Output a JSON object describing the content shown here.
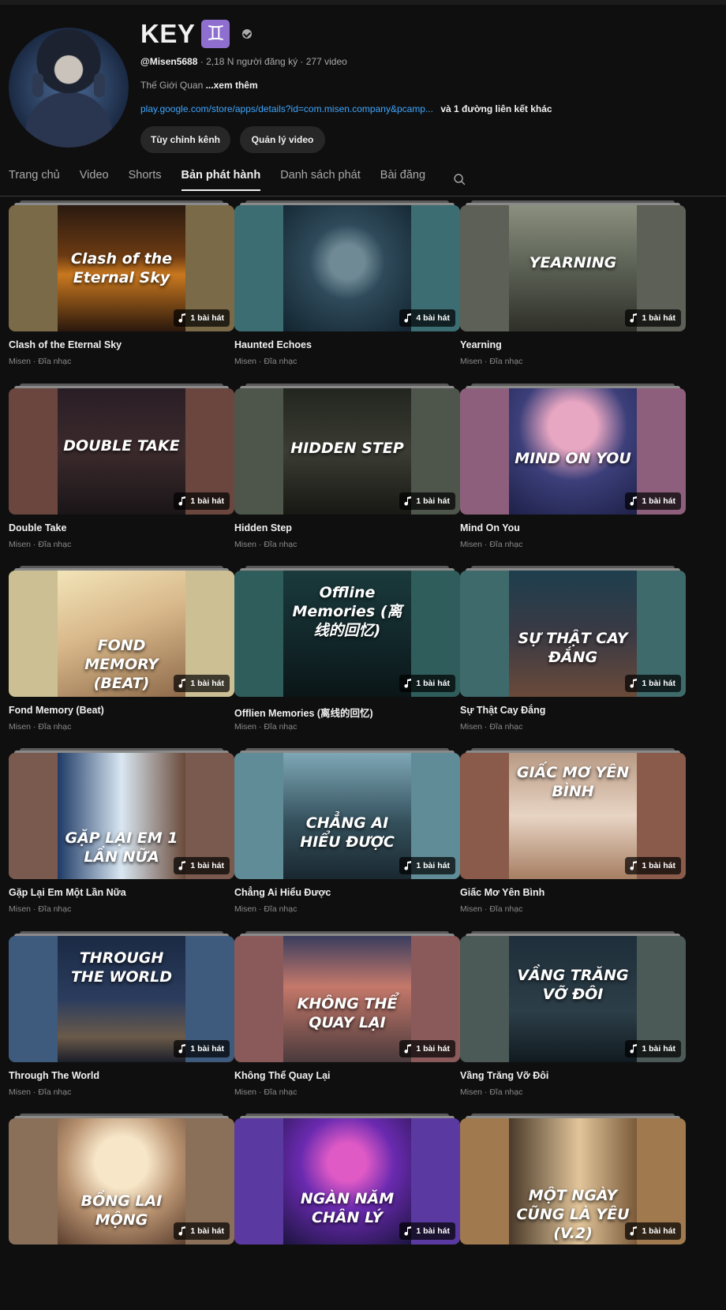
{
  "channel": {
    "name": "KEY",
    "badge_glyph": "♊",
    "handle": "@Misen5688",
    "subscribers": "2,18 N người đăng ký",
    "videos": "277 video",
    "description": "Thế Giới Quan",
    "read_more": "...xem thêm",
    "link": "play.google.com/store/apps/details?id=com.misen.company&pcamp...",
    "more_links": "và 1 đường liên kết khác",
    "avatar_icon": "anime-boy-headphones-avatar"
  },
  "buttons": {
    "customize": "Tùy chỉnh kênh",
    "manage": "Quản lý video"
  },
  "tabs": [
    {
      "label": "Trang chủ"
    },
    {
      "label": "Video"
    },
    {
      "label": "Shorts"
    },
    {
      "label": "Bản phát hành"
    },
    {
      "label": "Danh sách phát"
    },
    {
      "label": "Bài đăng"
    }
  ],
  "active_tab": "Bản phát hành",
  "colors": {
    "background": "#0f0f0f",
    "link": "#3ea6ff",
    "badge": "#8e6fd0",
    "button": "#272727"
  },
  "releases": [
    {
      "title": "Clash of the Eternal Sky",
      "sub": "Misen · Đĩa nhạc",
      "count": "1 bài hát",
      "cover_text": "Clash of the Eternal Sky",
      "cover_text_top": "35%",
      "bg": "linear-gradient(180deg,#2a1a10 0%,#6b3a12 40%,#c9781f 55%,#2a180c 100%)",
      "side": "#7b6a48"
    },
    {
      "title": "Haunted Echoes",
      "sub": "Misen · Đĩa nhạc",
      "count": "4 bài hát",
      "cover_text": "",
      "cover_text_top": "40%",
      "bg": "radial-gradient(circle at 50% 45%,#6f8a95 0 18%,#2f4a5a 40%,#12242f 100%)",
      "side": "#3b6d72"
    },
    {
      "title": "Yearning",
      "sub": "Misen · Đĩa nhạc",
      "count": "1 bài hát",
      "cover_text": "YEARNING",
      "cover_text_top": "38%",
      "bg": "linear-gradient(180deg,#8a8f7e 0%,#5f6558 45%,#2f3029 100%)",
      "side": "#5d6056"
    },
    {
      "title": "Double Take",
      "sub": "Misen · Đĩa nhạc",
      "count": "1 bài hát",
      "cover_text": "DOUBLE TAKE",
      "cover_text_top": "38%",
      "bg": "linear-gradient(180deg,#2a1e25 0%,#3b2a2c 50%,#1a1518 100%)",
      "side": "#6a463f"
    },
    {
      "title": "Hidden Step",
      "sub": "Misen · Đĩa nhạc",
      "count": "1 bài hát",
      "cover_text": "HIDDEN STEP",
      "cover_text_top": "40%",
      "bg": "linear-gradient(180deg,#22261f 0%,#3b3c33 50%,#171813 100%)",
      "side": "#4e564c"
    },
    {
      "title": "Mind On You",
      "sub": "Misen · Đĩa nhạc",
      "count": "1 bài hát",
      "cover_text": "MIND ON YOU",
      "cover_text_top": "48%",
      "bg": "radial-gradient(circle at 50% 30%,#e7a6c1 0 22%,#3c3f7a 50%,#1e2148 100%)",
      "side": "#8e5f7c"
    },
    {
      "title": "Fond Memory (Beat)",
      "sub": "Misen · Đĩa nhạc",
      "count": "1 bài hát",
      "cover_text": "FOND MEMORY (BEAT)",
      "cover_text_top": "52%",
      "bg": "linear-gradient(160deg,#f2e4b8 0%,#d8b88a 45%,#8e6a4a 100%)",
      "side": "#cbbf93"
    },
    {
      "title": "Offlien Memories (离线的回忆)",
      "sub": "Misen · Đĩa nhạc",
      "count": "1 bài hát",
      "cover_text": "Offline Memories (离线的回忆)",
      "cover_text_top": "10%",
      "bg": "linear-gradient(180deg,#1a3a3c 0%,#112528 60%,#0a1517 100%)",
      "side": "#2f5d5c"
    },
    {
      "title": "Sự Thật Cay Đắng",
      "sub": "Misen · Đĩa nhạc",
      "count": "1 bài hát",
      "cover_text": "SỰ THẬT CAY ĐẮNG",
      "cover_text_top": "46%",
      "bg": "linear-gradient(180deg,#1e3e4e 0%,#3a3a44 50%,#6a4a3a 100%)",
      "side": "#3f6a6c"
    },
    {
      "title": "Gặp Lại Em Một Lần Nữa",
      "sub": "Misen · Đĩa nhạc",
      "count": "1 bài hát",
      "cover_text": "GẶP LẠI EM 1 LẦN NỮA",
      "cover_text_top": "60%",
      "bg": "linear-gradient(90deg,#1e3a66 0%,#d9e7f2 50%,#6a4a3a 100%)",
      "side": "#7a5a4e"
    },
    {
      "title": "Chẳng Ai Hiểu Được",
      "sub": "Misen · Đĩa nhạc",
      "count": "1 bài hát",
      "cover_text": "CHẲNG AI HIỂU ĐƯỢC",
      "cover_text_top": "48%",
      "bg": "linear-gradient(180deg,#7ea7b6 0%,#34505c 55%,#1a2830 100%)",
      "side": "#5f8c96"
    },
    {
      "title": "Giấc Mơ Yên Bình",
      "sub": "Misen · Đĩa nhạc",
      "count": "1 bài hát",
      "cover_text": "GIẤC MƠ YÊN BÌNH",
      "cover_text_top": "8%",
      "bg": "linear-gradient(180deg,#b89a84 0%,#e8d4c4 50%,#a67e62 100%)",
      "side": "#8a5a4a"
    },
    {
      "title": "Through The World",
      "sub": "Misen · Đĩa nhạc",
      "count": "1 bài hát",
      "cover_text": "THROUGH THE WORLD",
      "cover_text_top": "10%",
      "bg": "linear-gradient(180deg,#1a2a44 0%,#2b3c5e 50%,#6a5a4a 80%,#1b1e2a 100%)",
      "side": "#3e5a7c"
    },
    {
      "title": "Không Thể Quay Lại",
      "sub": "Misen · Đĩa nhạc",
      "count": "1 bài hát",
      "cover_text": "KHÔNG THỂ QUAY LẠI",
      "cover_text_top": "46%",
      "bg": "linear-gradient(180deg,#3a3d5e 0%,#c4786a 40%,#4a3a3c 100%)",
      "side": "#8a5a5a"
    },
    {
      "title": "Vầng Trăng Vỡ Đôi",
      "sub": "Misen · Đĩa nhạc",
      "count": "1 bài hát",
      "cover_text": "VẦNG TRĂNG VỠ ĐÔI",
      "cover_text_top": "24%",
      "bg": "linear-gradient(180deg,#1e2e3a 0%,#2c3e48 60%,#111a20 100%)",
      "side": "#4b5a56"
    },
    {
      "title": "",
      "sub": "",
      "count": "1 bài hát",
      "cover_text": "BỒNG LAI MỘNG",
      "cover_text_top": "58%",
      "bg": "radial-gradient(circle at 50% 35%,#f7e6c8 0 25%,#b89270 55%,#5a3e2e 100%)",
      "side": "#8a7058"
    },
    {
      "title": "",
      "sub": "",
      "count": "1 bài hát",
      "cover_text": "NGÀN NĂM CHÂN LÝ",
      "cover_text_top": "56%",
      "bg": "radial-gradient(circle at 50% 35%,#e05ac6 0 18%,#6a2ab0 45%,#1c1440 100%)",
      "side": "#5a3aa0"
    },
    {
      "title": "",
      "sub": "",
      "count": "1 bài hát",
      "cover_text": "MỘT NGÀY CŨNG LÀ YÊU (V.2)",
      "cover_text_top": "54%",
      "bg": "linear-gradient(90deg,#4a3a2a 0%,#e2c59a 55%,#7a5a3a 100%)",
      "side": "#a07a4e"
    }
  ]
}
